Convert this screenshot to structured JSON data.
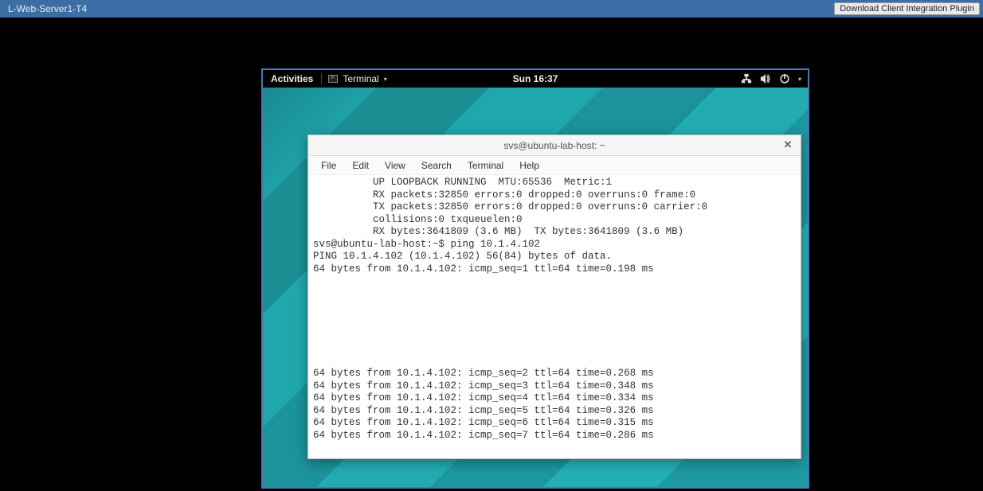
{
  "outer": {
    "title": "L-Web-Server1-T4",
    "download_button": "Download Client Integration Plugin"
  },
  "gnome": {
    "activities": "Activities",
    "app_name": "Terminal",
    "clock": "Sun 16:37"
  },
  "terminal_window": {
    "title": "svs@ubuntu-lab-host: ~",
    "close": "✕",
    "menus": {
      "file": "File",
      "edit": "Edit",
      "view": "View",
      "search": "Search",
      "terminal": "Terminal",
      "help": "Help"
    }
  },
  "terminal_output": {
    "l1": "          UP LOOPBACK RUNNING  MTU:65536  Metric:1",
    "l2": "          RX packets:32850 errors:0 dropped:0 overruns:0 frame:0",
    "l3": "          TX packets:32850 errors:0 dropped:0 overruns:0 carrier:0",
    "l4": "          collisions:0 txqueuelen:0",
    "l5": "          RX bytes:3641809 (3.6 MB)  TX bytes:3641809 (3.6 MB)",
    "l6": "",
    "l7": "svs@ubuntu-lab-host:~$ ping 10.1.4.102",
    "l8": "PING 10.1.4.102 (10.1.4.102) 56(84) bytes of data.",
    "l9": "64 bytes from 10.1.4.102: icmp_seq=1 ttl=64 time=0.198 ms",
    "l10": "64 bytes from 10.1.4.102: icmp_seq=2 ttl=64 time=0.268 ms",
    "l11": "64 bytes from 10.1.4.102: icmp_seq=3 ttl=64 time=0.348 ms",
    "l12": "64 bytes from 10.1.4.102: icmp_seq=4 ttl=64 time=0.334 ms",
    "l13": "64 bytes from 10.1.4.102: icmp_seq=5 ttl=64 time=0.326 ms",
    "l14": "64 bytes from 10.1.4.102: icmp_seq=6 ttl=64 time=0.315 ms",
    "l15": "64 bytes from 10.1.4.102: icmp_seq=7 ttl=64 time=0.286 ms"
  }
}
